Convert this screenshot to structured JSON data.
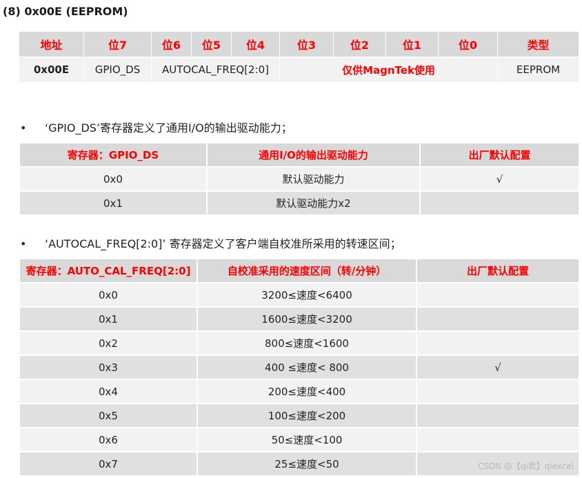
{
  "section_title": "(8) 0x00E (EEPROM)",
  "register_table": {
    "headers": [
      "地址",
      "位7",
      "位6",
      "位5",
      "位4",
      "位3",
      "位2",
      "位1",
      "位0",
      "类型"
    ],
    "row": {
      "address": "0x00E",
      "bit7": "GPIO_DS",
      "bits6_4": "AUTOCAL_FREQ[2:0]",
      "bits3_0": "仅供MagnTek使用",
      "type": "EEPROM"
    }
  },
  "gpio_section": {
    "bullet": "•",
    "description": "‘GPIO_DS’寄存器定义了通用I/O的输出驱动能力；",
    "headers": [
      "寄存器：GPIO_DS",
      "通用I/O的输出驱动能力",
      "出厂默认配置"
    ],
    "rows": [
      [
        "0x0",
        "默认驱动能力",
        "√"
      ],
      [
        "0x1",
        "默认驱动能力x2",
        ""
      ]
    ]
  },
  "freq_section": {
    "bullet": "•",
    "description": "‘AUTOCAL_FREQ[2:0]’ 寄存器定义了客户端自校准所采用的转速区间；",
    "headers": [
      "寄存器：AUTO_CAL_FREQ[2:0]",
      "自校准采用的速度区间（转/分钟）",
      "出厂默认配置"
    ],
    "rows": [
      [
        "0x0",
        "3200≤速度<6400",
        ""
      ],
      [
        "0x1",
        "1600≤速度<3200",
        ""
      ],
      [
        "0x2",
        "800≤速度<1600",
        ""
      ],
      [
        "0x3",
        "400 ≤速度< 800",
        "√"
      ],
      [
        "0x4",
        "200≤速度<400",
        ""
      ],
      [
        "0x5",
        "100≤速度<200",
        ""
      ],
      [
        "0x6",
        "50≤速度<100",
        ""
      ],
      [
        "0x7",
        "25≤速度<50",
        ""
      ]
    ]
  },
  "watermark": "CSDN @【qi君】qiexcel"
}
